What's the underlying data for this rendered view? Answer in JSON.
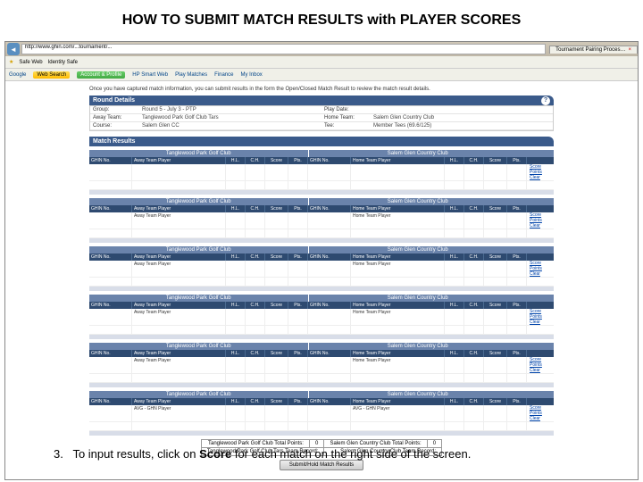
{
  "heading": "HOW TO SUBMIT MATCH RESULTS with PLAYER SCORES",
  "browser": {
    "url": "http://www.ghin.com/...tournament/...",
    "tab_title": "Tournament Pairing Proces…",
    "toolbar": {
      "safe_web": "Safe Web",
      "identity": "Identity Safe"
    },
    "bookmarks": {
      "google": "Google",
      "search": "Web Search",
      "account": "Account & Profile",
      "hp": "HP Smart Web",
      "play": "Play Matches",
      "finance": "Finance",
      "inbox": "My Inbox"
    }
  },
  "instr_text": "Once you have captured match information, you can submit results in the form the Open/Closed Match Result to review the match result details.",
  "round_details": {
    "title": "Round Details",
    "labels": {
      "group": "Group:",
      "away": "Away Team:",
      "course": "Course:",
      "play_date": "Play Date:",
      "home": "Home Team:",
      "tee": "Tee:"
    },
    "values": {
      "group": "Round 5 - July 3 - PTP",
      "away": "Tanglewood Park Golf Club Tars",
      "course": "Salem Glen CC",
      "play_date": "",
      "home": "Salem Glen Country Club",
      "tee": "Member Tees (69.6/125)"
    }
  },
  "match_results": {
    "title": "Match Results"
  },
  "team_sub": {
    "away": "Tanglewood Park Golf Club",
    "home": "Salem Glen Country Club"
  },
  "cols": {
    "ghin": "GHIN No.",
    "away_player": "Away Team Player",
    "home_player": "Home Team Player",
    "hl": "H.L.",
    "ci": "C.H.",
    "score": "Score",
    "pts": "Pts."
  },
  "links": {
    "score": "Score",
    "points": "Points",
    "clear": "Clear"
  },
  "matches": [
    {
      "away_name": "",
      "home_name": ""
    },
    {
      "away_name": "Away Team Player",
      "home_name": "Home Team Player"
    },
    {
      "away_name": "Away Team Player",
      "home_name": "Home Team Player"
    },
    {
      "away_name": "Away Team Player",
      "home_name": "Home Team Player"
    },
    {
      "away_name": "Away Team Player",
      "home_name": "Home Team Player"
    },
    {
      "away_name": "AVG - GHN Player",
      "home_name": "AVG - GHN Player"
    }
  ],
  "totals": {
    "r1l": "Tanglewood Park Golf Club Total Points:",
    "r1v": "0",
    "r2l": "Tanglewood Park Golf Club Tars Team Record:",
    "r3l": "Salem Glen Country Club Total Points:",
    "r3v": "0",
    "r4l": "Salem Glen Country Club Team Record:"
  },
  "submit_label": "Submit/Hold Match Results",
  "footer": {
    "num": "3.",
    "text_a": "To input results, click on ",
    "bold": "Score",
    "text_b": " for each match on the right side of the screen."
  }
}
